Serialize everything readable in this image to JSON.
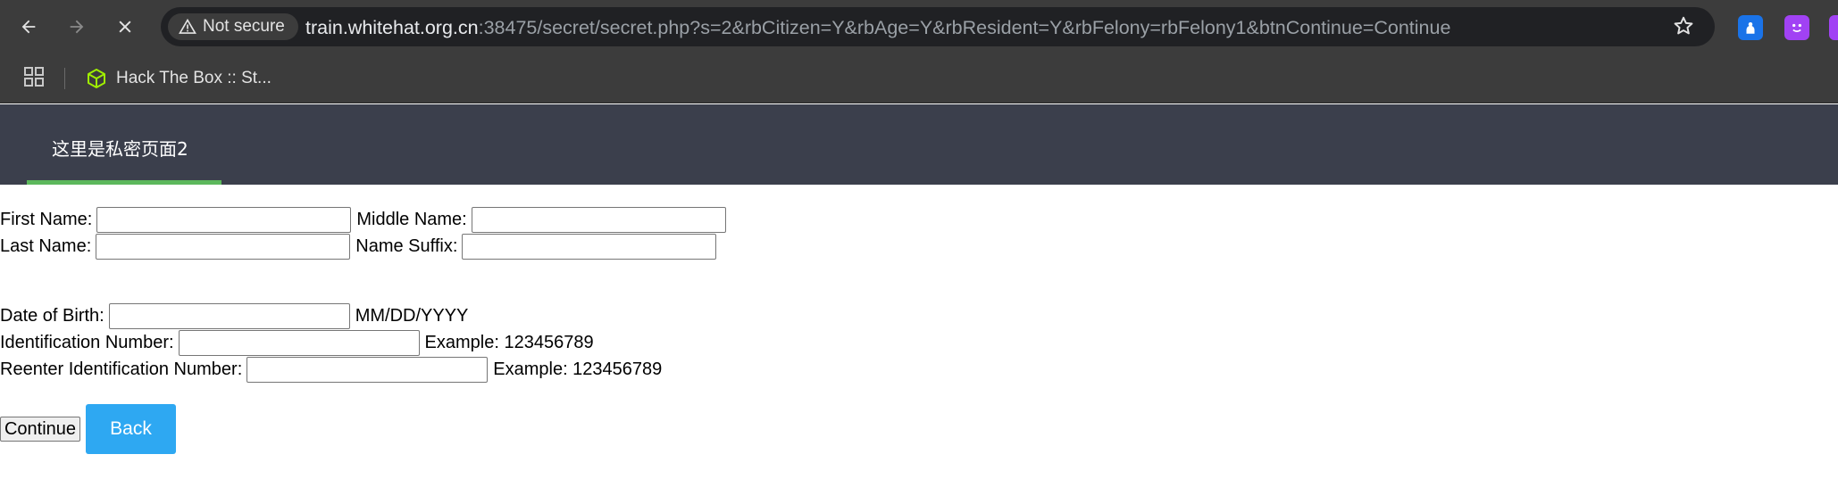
{
  "browser": {
    "security_label": "Not secure",
    "url_host": "train.whitehat.org.cn",
    "url_rest": ":38475/secret/secret.php?s=2&rbCitizen=Y&rbAge=Y&rbResident=Y&rbFelony=rbFelony1&btnContinue=Continue",
    "bookmark_label": "Hack The Box :: St..."
  },
  "page": {
    "header_title": "这里是私密页面2"
  },
  "form": {
    "first_name_label": "First Name:",
    "middle_name_label": "Middle Name:",
    "last_name_label": "Last Name:",
    "name_suffix_label": "Name Suffix:",
    "dob_label": "Date of Birth:",
    "dob_hint": "MM/DD/YYYY",
    "id_label": "Identification Number:",
    "id_hint": "Example: 123456789",
    "reenter_id_label": "Reenter Identification Number:",
    "reenter_id_hint": "Example: 123456789",
    "first_name_value": "",
    "middle_name_value": "",
    "last_name_value": "",
    "name_suffix_value": "",
    "dob_value": "",
    "id_value": "",
    "reenter_id_value": ""
  },
  "buttons": {
    "continue_label": "Continue",
    "back_label": "Back"
  },
  "colors": {
    "header_bg": "#3b3f4c",
    "tab_underline": "#5cb85c",
    "back_button": "#2ea8f2"
  }
}
